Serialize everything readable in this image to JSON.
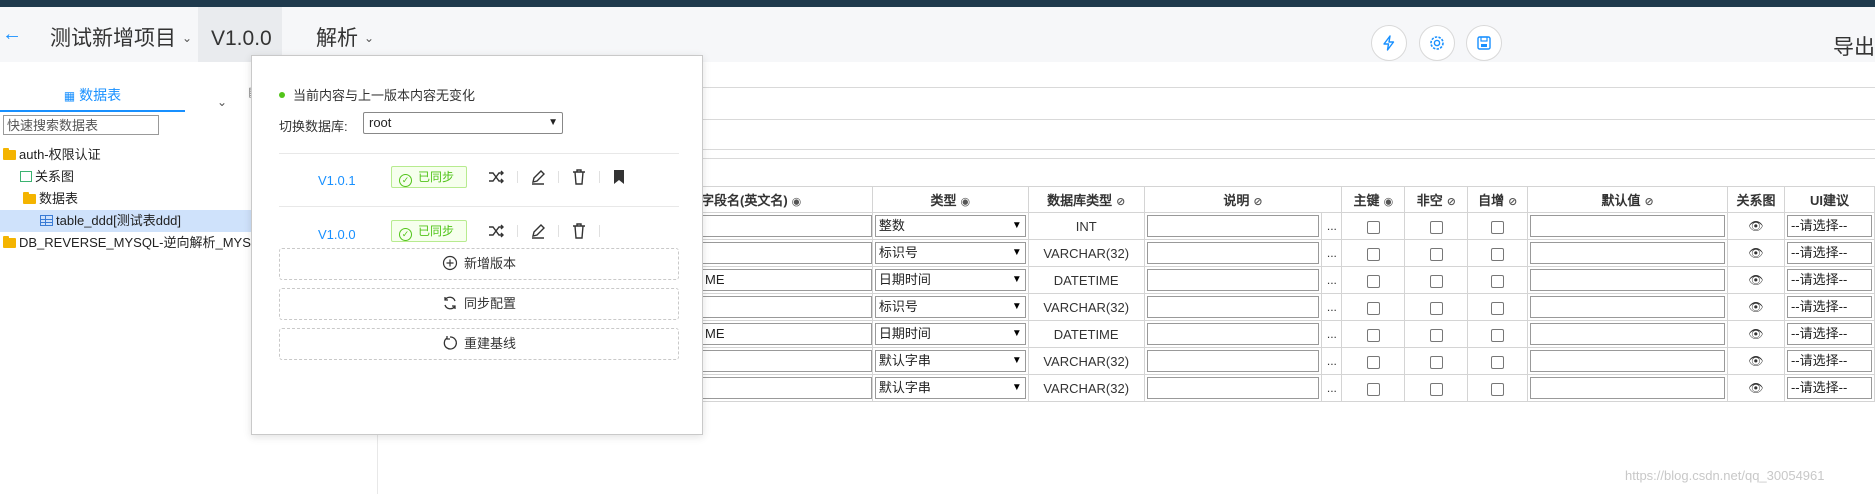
{
  "header": {
    "back_icon": "arrow-left-icon",
    "project": "测试新增项目",
    "version": "V1.0.0",
    "parse": "解析",
    "export": "导出",
    "icons": [
      "lightning-icon",
      "gear-icon",
      "save-icon"
    ]
  },
  "sidebar": {
    "tab_tables": "数据表",
    "tab_other": "⬛",
    "search_placeholder": "快速搜索数据表",
    "tree": [
      {
        "label": "auth-权限认证",
        "icon": "folder-icon"
      },
      {
        "label": "关系图",
        "icon": "relation-icon"
      },
      {
        "label": "数据表",
        "icon": "folder-icon"
      },
      {
        "label": "table_ddd[测试表ddd]",
        "icon": "table-icon",
        "selected": true
      },
      {
        "label": "DB_REVERSE_MYSQL-逆向解析_MYSQ",
        "icon": "folder-icon"
      }
    ]
  },
  "popover": {
    "status": "当前内容与上一版本内容无变化",
    "switch_label": "切换数据库:",
    "db_value": "root",
    "versions": [
      {
        "name": "V1.0.1",
        "tag": "已同步",
        "has_baseline": true
      },
      {
        "name": "V1.0.0",
        "tag": "已同步",
        "has_baseline": false
      }
    ],
    "buttons": {
      "new_version": "新增版本",
      "sync_config": "同步配置",
      "rebuild_baseline": "重建基线"
    }
  },
  "grid": {
    "headers": {
      "name": "字段名(英文名)",
      "type": "类型",
      "dbtype": "数据库类型",
      "desc": "说明",
      "pk": "主键",
      "notnull": "非空",
      "autoinc": "自增",
      "default": "默认值",
      "relation": "关系图",
      "ui": "UI建议"
    },
    "rows": [
      {
        "name": "",
        "type": "整数",
        "dbtype": "INT",
        "ui": "--请选择--"
      },
      {
        "name": "",
        "type": "标识号",
        "dbtype": "VARCHAR(32)",
        "ui": "--请选择--"
      },
      {
        "name": "ME",
        "type": "日期时间",
        "dbtype": "DATETIME",
        "ui": "--请选择--"
      },
      {
        "name": "",
        "type": "标识号",
        "dbtype": "VARCHAR(32)",
        "ui": "--请选择--"
      },
      {
        "name": "ME",
        "type": "日期时间",
        "dbtype": "DATETIME",
        "ui": "--请选择--"
      },
      {
        "name": "",
        "type": "默认字串",
        "dbtype": "VARCHAR(32)",
        "ui": "--请选择--"
      },
      {
        "name": "",
        "type": "默认字串",
        "dbtype": "VARCHAR(32)",
        "ui": "--请选择--"
      }
    ],
    "ellipsis": "...",
    "eye_glyph": "👁"
  },
  "watermark": "https://blog.csdn.net/qq_30054961",
  "colors": {
    "accent": "#1890ff",
    "success": "#52c41a",
    "topbar": "#1f3a4d"
  }
}
